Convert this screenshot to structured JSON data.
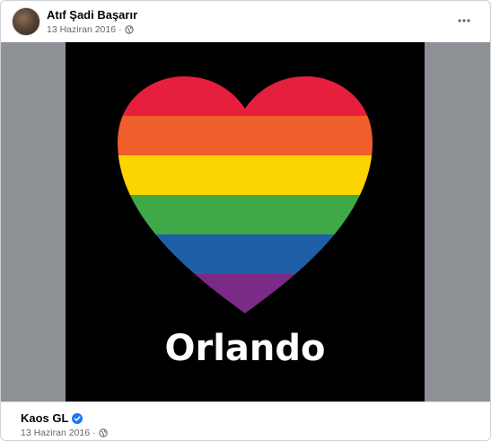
{
  "post": {
    "author": "Atıf Şadi Başarır",
    "date": "13 Haziran 2016",
    "separator": "·",
    "privacy_icon": "globe-icon",
    "more_icon": "more-options-icon"
  },
  "image": {
    "text": "Orlando",
    "stripe_colors": [
      "#e61f3e",
      "#ef5e2b",
      "#fcd500",
      "#3fa847",
      "#1f5fa7",
      "#7a2b86"
    ],
    "background": "#000000"
  },
  "shared": {
    "page_name": "Kaos GL",
    "verified_icon": "verified-badge-icon",
    "date": "13 Haziran 2016",
    "separator": "·",
    "privacy_icon": "globe-icon"
  }
}
